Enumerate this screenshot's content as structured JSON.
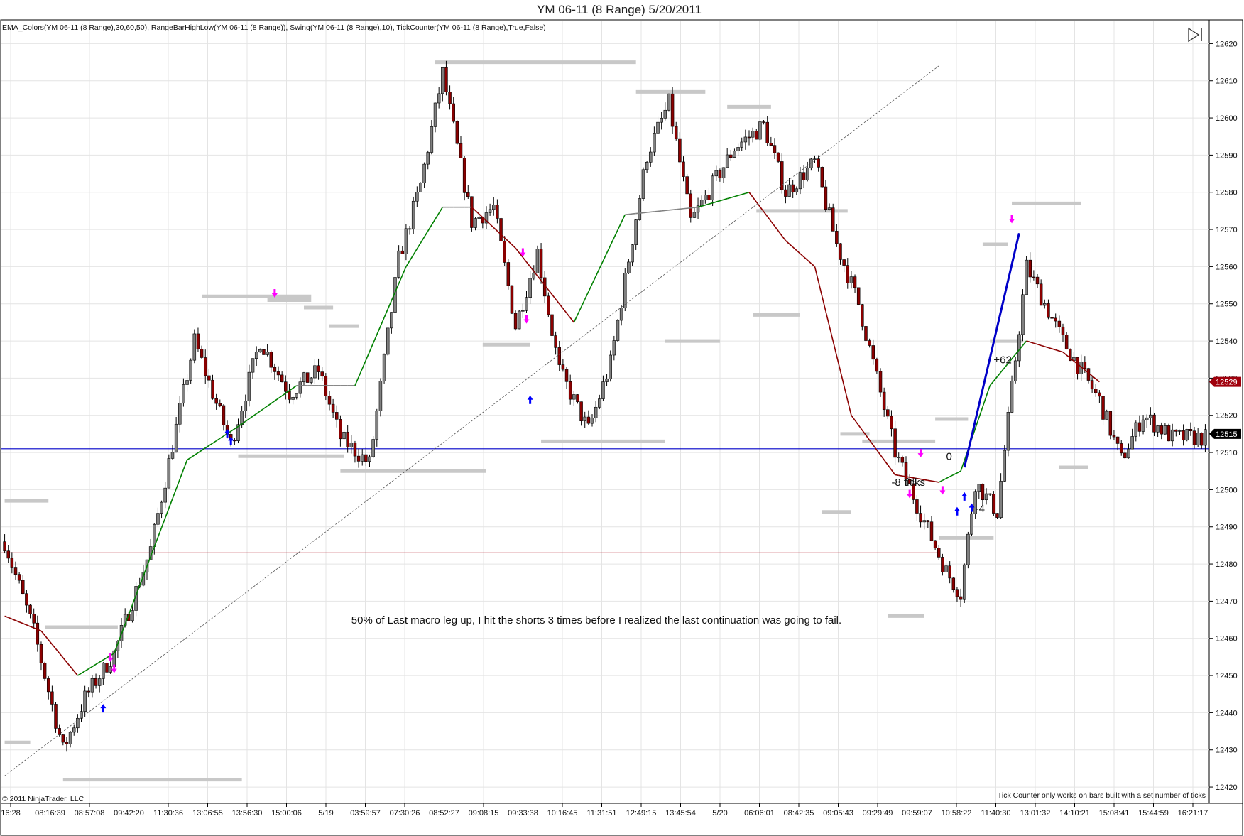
{
  "window": {
    "title": "YM 06-11 (8 Range)  5/20/2011",
    "indicator_line": "EMA_Colors(YM 06-11 (8 Range),30,60,50), RangeBarHighLow(YM 06-11 (8 Range)), Swing(YM 06-11 (8 Range),10), TickCounter(YM 06-11 (8 Range),True,False)",
    "copyright": "© 2011 NinjaTrader, LLC",
    "footnote": "Tick Counter only works on bars built with a set number of ticks",
    "icons": [
      "play-forward-icon"
    ]
  },
  "colors": {
    "up_candle": "#808080",
    "down_candle": "#8b0000",
    "ema_up": "#008000",
    "ema_down": "#8b0000",
    "ema_neutral": "#808080",
    "swing": "#c8c8c8",
    "blue_line": "#0000c8",
    "red_line": "#c0404c",
    "buy_arrow": "#0000ff",
    "sell_arrow": "#ff00ff",
    "price_badge_red": "#a0000c",
    "price_badge_black": "#000000"
  },
  "chart_data": {
    "type": "candlestick",
    "title": "YM 06-11 (8 Range)  5/20/2011",
    "xlabel": "",
    "ylabel": "",
    "ylim": [
      12416,
      12626
    ],
    "y_ticks": [
      12420,
      12430,
      12440,
      12450,
      12460,
      12470,
      12480,
      12490,
      12500,
      12510,
      12520,
      12530,
      12540,
      12550,
      12560,
      12570,
      12580,
      12590,
      12600,
      12610,
      12620
    ],
    "x_tick_labels": [
      "16:28",
      "08:16:39",
      "08:57:08",
      "09:42:20",
      "11:30:36",
      "13:06:55",
      "13:56:30",
      "15:00:06",
      "5/19",
      "03:59:57",
      "07:30:26",
      "08:52:27",
      "09:08:15",
      "09:33:38",
      "10:16:45",
      "11:31:51",
      "12:49:15",
      "13:45:54",
      "5/20",
      "06:06:01",
      "08:42:35",
      "09:05:43",
      "09:29:49",
      "09:59:07",
      "10:58:22",
      "11:40:30",
      "13:01:32",
      "14:10:21",
      "15:08:41",
      "15:44:59",
      "16:21:17"
    ],
    "bar_count": 330,
    "price_path": [
      [
        0,
        12486
      ],
      [
        8,
        12462
      ],
      [
        16,
        12430
      ],
      [
        22,
        12444
      ],
      [
        30,
        12456
      ],
      [
        40,
        12484
      ],
      [
        52,
        12540
      ],
      [
        62,
        12512
      ],
      [
        70,
        12540
      ],
      [
        78,
        12526
      ],
      [
        86,
        12532
      ],
      [
        92,
        12514
      ],
      [
        100,
        12507
      ],
      [
        108,
        12562
      ],
      [
        114,
        12582
      ],
      [
        120,
        12612
      ],
      [
        128,
        12572
      ],
      [
        134,
        12576
      ],
      [
        140,
        12544
      ],
      [
        146,
        12564
      ],
      [
        152,
        12532
      ],
      [
        160,
        12516
      ],
      [
        166,
        12534
      ],
      [
        176,
        12590
      ],
      [
        182,
        12604
      ],
      [
        188,
        12572
      ],
      [
        200,
        12592
      ],
      [
        208,
        12598
      ],
      [
        214,
        12580
      ],
      [
        222,
        12588
      ],
      [
        228,
        12566
      ],
      [
        234,
        12550
      ],
      [
        244,
        12510
      ],
      [
        250,
        12496
      ],
      [
        258,
        12478
      ],
      [
        262,
        12472
      ],
      [
        266,
        12502
      ],
      [
        272,
        12494
      ],
      [
        280,
        12560
      ],
      [
        290,
        12540
      ],
      [
        300,
        12524
      ],
      [
        306,
        12508
      ],
      [
        312,
        12520
      ],
      [
        320,
        12514
      ]
    ],
    "ema": [
      [
        0,
        12466
      ],
      [
        10,
        12462
      ],
      [
        20,
        12450
      ],
      [
        30,
        12456
      ],
      [
        40,
        12482
      ],
      [
        50,
        12508
      ],
      [
        64,
        12517
      ],
      [
        80,
        12528
      ],
      [
        96,
        12528
      ],
      [
        110,
        12560
      ],
      [
        120,
        12576
      ],
      [
        128,
        12576
      ],
      [
        140,
        12565
      ],
      [
        156,
        12545
      ],
      [
        170,
        12574
      ],
      [
        190,
        12576
      ],
      [
        204,
        12580
      ],
      [
        214,
        12567
      ],
      [
        222,
        12560
      ],
      [
        232,
        12520
      ],
      [
        244,
        12504
      ],
      [
        256,
        12502
      ],
      [
        262,
        12505
      ],
      [
        270,
        12528
      ],
      [
        280,
        12540
      ],
      [
        290,
        12537
      ],
      [
        300,
        12529
      ]
    ],
    "swing_levels": [
      {
        "x": [
          118,
          173
        ],
        "y": 12615
      },
      {
        "x": [
          173,
          192
        ],
        "y": 12607
      },
      {
        "x": [
          198,
          210
        ],
        "y": 12603
      },
      {
        "x": [
          0,
          12
        ],
        "y": 12497
      },
      {
        "x": [
          0,
          7
        ],
        "y": 12432
      },
      {
        "x": [
          16,
          65
        ],
        "y": 12422
      },
      {
        "x": [
          11,
          31
        ],
        "y": 12463
      },
      {
        "x": [
          54,
          84
        ],
        "y": 12552
      },
      {
        "x": [
          72,
          84
        ],
        "y": 12551
      },
      {
        "x": [
          82,
          90
        ],
        "y": 12549
      },
      {
        "x": [
          89,
          97
        ],
        "y": 12544
      },
      {
        "x": [
          64,
          93
        ],
        "y": 12509
      },
      {
        "x": [
          92,
          132
        ],
        "y": 12505
      },
      {
        "x": [
          131,
          144
        ],
        "y": 12539
      },
      {
        "x": [
          147,
          181
        ],
        "y": 12513
      },
      {
        "x": [
          181,
          196
        ],
        "y": 12540
      },
      {
        "x": [
          206,
          231
        ],
        "y": 12575
      },
      {
        "x": [
          205,
          218
        ],
        "y": 12547
      },
      {
        "x": [
          229,
          237
        ],
        "y": 12515
      },
      {
        "x": [
          224,
          232
        ],
        "y": 12494
      },
      {
        "x": [
          235,
          255
        ],
        "y": 12513
      },
      {
        "x": [
          242,
          252
        ],
        "y": 12466
      },
      {
        "x": [
          255,
          264
        ],
        "y": 12519
      },
      {
        "x": [
          256,
          271
        ],
        "y": 12487
      },
      {
        "x": [
          268,
          275
        ],
        "y": 12566
      },
      {
        "x": [
          270,
          279
        ],
        "y": 12540
      },
      {
        "x": [
          276,
          295
        ],
        "y": 12577
      },
      {
        "x": [
          289,
          297
        ],
        "y": 12506
      }
    ],
    "horizontal_lines": [
      {
        "name": "blue",
        "y": 12511
      },
      {
        "name": "red",
        "y": 12483
      }
    ],
    "trend_line": [
      [
        0,
        12423
      ],
      [
        256,
        12614
      ]
    ],
    "blue_leg": [
      [
        263,
        12506
      ],
      [
        278,
        12569
      ]
    ],
    "annotations": [
      {
        "text": "50% of Last macro leg up, I hit the shorts 3 times before I realized the last continuation was going to fail.",
        "x": 95,
        "y": 12464
      },
      {
        "text": "+62",
        "x": 271,
        "y": 12534
      },
      {
        "text": "-8 ticks",
        "x": 243,
        "y": 12501
      },
      {
        "text": "0",
        "x": 258,
        "y": 12508
      },
      {
        "text": "-4",
        "x": 266,
        "y": 12494
      }
    ],
    "price_badges": [
      {
        "value": "12529",
        "y": 12529
      },
      {
        "value": "12515",
        "y": 12515
      }
    ],
    "grid": true,
    "legend": "none"
  }
}
